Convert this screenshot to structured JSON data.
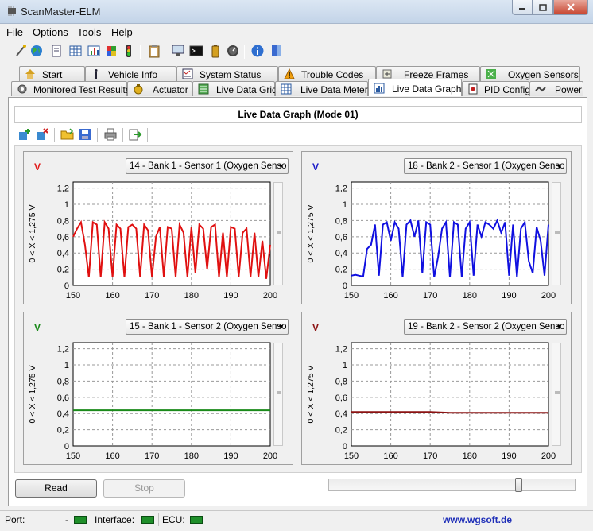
{
  "window": {
    "title": "ScanMaster-ELM"
  },
  "menu": [
    "File",
    "Options",
    "Tools",
    "Help"
  ],
  "toolbar_icons": [
    "wand-icon",
    "globe-icon",
    "document-icon",
    "grid-icon",
    "chart-icon",
    "flag-icon",
    "traffic-light-icon",
    "clipboard-icon",
    "monitor-icon",
    "terminal-icon",
    "battery-icon",
    "gauge-icon",
    "info-icon",
    "book-icon"
  ],
  "tabs_row1": [
    {
      "label": "Start",
      "icon": "home-icon"
    },
    {
      "label": "Vehicle Info",
      "icon": "info-icon"
    },
    {
      "label": "System Status",
      "icon": "checklist-icon"
    },
    {
      "label": "Trouble Codes",
      "icon": "warning-icon"
    },
    {
      "label": "Freeze Frames",
      "icon": "snowflake-icon"
    },
    {
      "label": "Oxygen Sensors",
      "icon": "sensor-icon"
    }
  ],
  "tabs_row2": [
    {
      "label": "Monitored Test Results",
      "icon": "gear-icon"
    },
    {
      "label": "Actuator",
      "icon": "actuator-icon"
    },
    {
      "label": "Live Data Grid",
      "icon": "list-icon"
    },
    {
      "label": "Live Data Meter",
      "icon": "grid-icon"
    },
    {
      "label": "Live Data Graph",
      "icon": "graph-icon",
      "active": true
    },
    {
      "label": "PID Config",
      "icon": "config-icon"
    },
    {
      "label": "Power",
      "icon": "power-icon"
    }
  ],
  "panel_title": "Live Data Graph (Mode 01)",
  "graph_toolbar_icons": [
    "add-graph-icon",
    "remove-graph-icon",
    "open-folder-icon",
    "save-icon",
    "print-icon",
    "export-icon"
  ],
  "axis_ylabel": "0  < X <  1,275  V",
  "graphs": [
    {
      "unit": "V",
      "unit_color": "#e21b1b",
      "sensor": "14 - Bank 1 - Sensor 1 (Oxygen Senso",
      "line_color": "#e01010"
    },
    {
      "unit": "V",
      "unit_color": "#1c1cc8",
      "sensor": "18 - Bank 2 - Sensor 1 (Oxygen Senso",
      "line_color": "#1010e0"
    },
    {
      "unit": "V",
      "unit_color": "#1a8a1a",
      "sensor": "15 - Bank 1 - Sensor 2 (Oxygen Senso",
      "line_color": "#1a8a1a"
    },
    {
      "unit": "V",
      "unit_color": "#8b1212",
      "sensor": "19 - Bank 2 - Sensor 2 (Oxygen Senso",
      "line_color": "#8b1212"
    }
  ],
  "chart_data": [
    {
      "type": "line",
      "series": [
        {
          "name": "14 - Bank 1 - Sensor 1 (Oxygen Senso",
          "values": [
            0.6,
            0.7,
            0.78,
            0.5,
            0.1,
            0.78,
            0.75,
            0.1,
            0.78,
            0.7,
            0.1,
            0.75,
            0.7,
            0.1,
            0.72,
            0.75,
            0.7,
            0.1,
            0.75,
            0.68,
            0.1,
            0.6,
            0.72,
            0.1,
            0.72,
            0.7,
            0.1,
            0.75,
            0.65,
            0.1,
            0.72,
            0.15,
            0.75,
            0.7,
            0.2,
            0.72,
            0.75,
            0.1,
            0.65,
            0.1,
            0.72,
            0.7,
            0.1,
            0.65,
            0.7,
            0.1,
            0.65,
            0.1,
            0.55,
            0.08,
            0.5
          ]
        }
      ],
      "x": [
        150,
        151,
        152,
        153,
        154,
        155,
        156,
        157,
        158,
        159,
        160,
        161,
        162,
        163,
        164,
        165,
        166,
        167,
        168,
        169,
        170,
        171,
        172,
        173,
        174,
        175,
        176,
        177,
        178,
        179,
        180,
        181,
        182,
        183,
        184,
        185,
        186,
        187,
        188,
        189,
        190,
        191,
        192,
        193,
        194,
        195,
        196,
        197,
        198,
        199,
        200
      ],
      "xlim": [
        150,
        200
      ],
      "ylim": [
        0,
        1.275
      ],
      "xticks": [
        150,
        160,
        170,
        180,
        190,
        200
      ],
      "yticks": [
        "0",
        "0,2",
        "0,4",
        "0,6",
        "0,8",
        "1",
        "1,2"
      ],
      "ylabel": "0  < X <  1,275  V"
    },
    {
      "type": "line",
      "series": [
        {
          "name": "18 - Bank 2 - Sensor 1 (Oxygen Senso",
          "values": [
            0.12,
            0.13,
            0.12,
            0.11,
            0.45,
            0.5,
            0.75,
            0.12,
            0.75,
            0.78,
            0.55,
            0.78,
            0.7,
            0.1,
            0.75,
            0.8,
            0.6,
            0.8,
            0.15,
            0.78,
            0.75,
            0.1,
            0.35,
            0.7,
            0.78,
            0.1,
            0.78,
            0.75,
            0.1,
            0.7,
            0.78,
            0.12,
            0.75,
            0.6,
            0.78,
            0.75,
            0.7,
            0.8,
            0.65,
            0.78,
            0.12,
            0.75,
            0.1,
            0.7,
            0.78,
            0.3,
            0.15,
            0.72,
            0.55,
            0.12,
            0.75
          ]
        }
      ],
      "x": [
        150,
        151,
        152,
        153,
        154,
        155,
        156,
        157,
        158,
        159,
        160,
        161,
        162,
        163,
        164,
        165,
        166,
        167,
        168,
        169,
        170,
        171,
        172,
        173,
        174,
        175,
        176,
        177,
        178,
        179,
        180,
        181,
        182,
        183,
        184,
        185,
        186,
        187,
        188,
        189,
        190,
        191,
        192,
        193,
        194,
        195,
        196,
        197,
        198,
        199,
        200
      ],
      "xlim": [
        150,
        200
      ],
      "ylim": [
        0,
        1.275
      ],
      "xticks": [
        150,
        160,
        170,
        180,
        190,
        200
      ],
      "yticks": [
        "0",
        "0,2",
        "0,4",
        "0,6",
        "0,8",
        "1",
        "1,2"
      ],
      "ylabel": "0  < X <  1,275  V"
    },
    {
      "type": "line",
      "series": [
        {
          "name": "15 - Bank 1 - Sensor 2 (Oxygen Senso",
          "values": [
            0.44,
            0.44,
            0.44,
            0.44,
            0.44,
            0.44
          ]
        }
      ],
      "x": [
        150,
        160,
        170,
        180,
        190,
        200
      ],
      "xlim": [
        150,
        200
      ],
      "ylim": [
        0,
        1.275
      ],
      "xticks": [
        150,
        160,
        170,
        180,
        190,
        200
      ],
      "yticks": [
        "0",
        "0,2",
        "0,4",
        "0,6",
        "0,8",
        "1",
        "1,2"
      ],
      "ylabel": "0  < X <  1,275  V"
    },
    {
      "type": "line",
      "series": [
        {
          "name": "19 - Bank 2 - Sensor 2 (Oxygen Senso",
          "values": [
            0.42,
            0.42,
            0.42,
            0.42,
            0.42,
            0.41,
            0.41,
            0.41,
            0.41,
            0.41,
            0.41
          ]
        }
      ],
      "x": [
        150,
        155,
        160,
        165,
        170,
        175,
        180,
        185,
        190,
        195,
        200
      ],
      "xlim": [
        150,
        200
      ],
      "ylim": [
        0,
        1.275
      ],
      "xticks": [
        150,
        160,
        170,
        180,
        190,
        200
      ],
      "yticks": [
        "0",
        "0,2",
        "0,4",
        "0,6",
        "0,8",
        "1",
        "1,2"
      ],
      "ylabel": "0  < X <  1,275  V"
    }
  ],
  "buttons": {
    "read": "Read",
    "stop": "Stop"
  },
  "slider": {
    "position": 0.78
  },
  "status": {
    "port_label": "Port:",
    "port_value": "-",
    "interface_label": "Interface:",
    "ecu_label": "ECU:",
    "website": "www.wgsoft.de",
    "led_color": "#1f8f2a"
  }
}
